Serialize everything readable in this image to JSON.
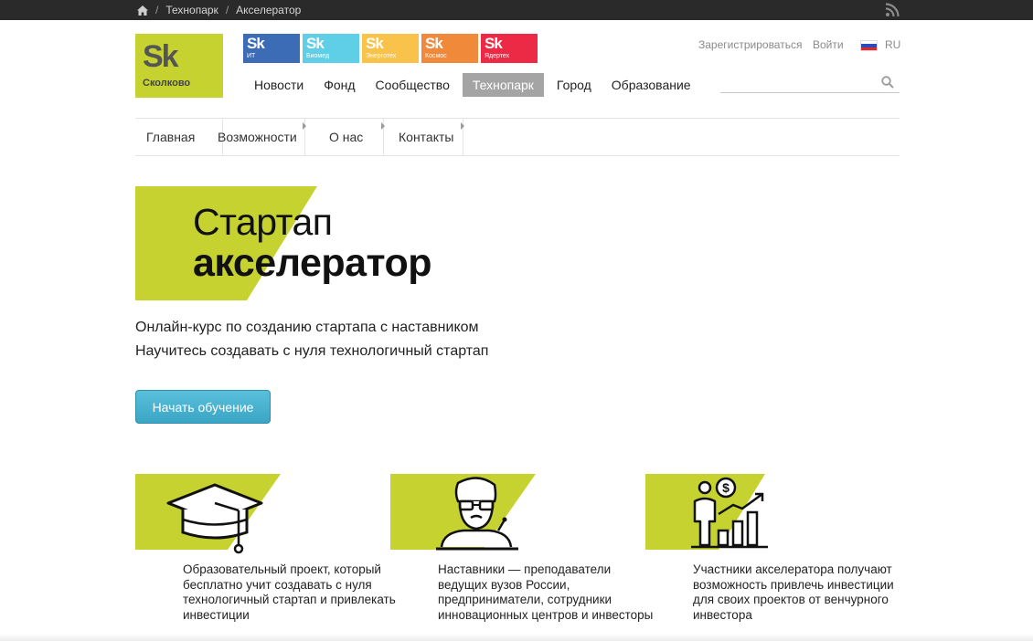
{
  "topbar": {
    "breadcrumbs": [
      "Технопарк",
      "Акселератор"
    ],
    "separator": "/"
  },
  "header": {
    "logo": {
      "mark": "Sk",
      "name": "Сколково",
      "color": "#c5d22f"
    },
    "clusters": [
      {
        "mark": "Sk",
        "label": "ИТ",
        "color": "#3c6cb5"
      },
      {
        "mark": "Sk",
        "label": "Биомед",
        "color": "#5ecfe6"
      },
      {
        "mark": "Sk",
        "label": "Энерготех",
        "color": "#f9c24a"
      },
      {
        "mark": "Sk",
        "label": "Космос",
        "color": "#f08a3a"
      },
      {
        "mark": "Sk",
        "label": "Ядертех",
        "color": "#ec2a45"
      }
    ],
    "register": "Зарегистрироваться",
    "login": "Войти",
    "language": "RU",
    "nav": [
      "Новости",
      "Фонд",
      "Сообщество",
      "Технопарк",
      "Город",
      "Образование"
    ],
    "nav_active": "Технопарк",
    "search": {
      "value": "",
      "placeholder": ""
    }
  },
  "subnav": [
    "Главная",
    "Возможности",
    "О нас",
    "Контакты"
  ],
  "hero": {
    "title_line1": "Стартап",
    "title_line2": "акселератор",
    "subtitle1": "Онлайн-курс по созданию стартапа с наставником",
    "subtitle2": "Научитесь создавать с нуля технологичный стартап",
    "cta": "Начать обучение"
  },
  "features": [
    {
      "icon": "graduation-cap-icon",
      "text": "Образовательный проект, который бесплатно учит создавать с нуля технологичный стартап и привлекать инвестиции"
    },
    {
      "icon": "mentor-icon",
      "text": "Наставники — преподаватели ведущих вузов России, предприниматели, сотрудники инновационных центров и инвесторы"
    },
    {
      "icon": "investor-growth-icon",
      "text": "Участники акселератора получают возможность привлечь инвестиции для своих проектов от венчурного инвестора"
    }
  ],
  "colors": {
    "accent": "#c5d22f",
    "cta": "#3aa5c4",
    "topbar": "#2a2a2a",
    "nav_active_bg": "#a4a4a4"
  }
}
